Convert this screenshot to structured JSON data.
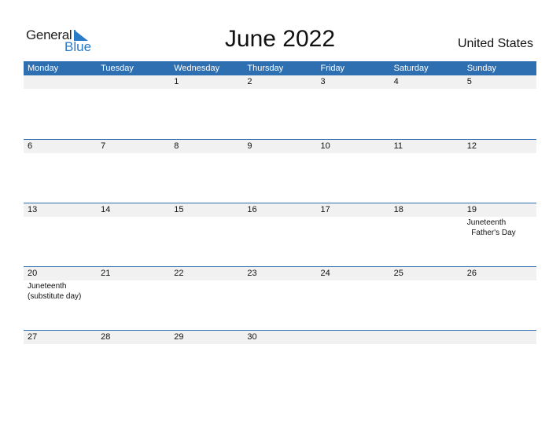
{
  "logo": {
    "word1": "General",
    "word2": "Blue"
  },
  "title": "June 2022",
  "country": "United States",
  "colors": {
    "header_bg": "#2e6fb1",
    "brand_blue": "#2a7bc7",
    "daynum_bg": "#f1f1f1"
  },
  "weekdays": [
    "Monday",
    "Tuesday",
    "Wednesday",
    "Thursday",
    "Friday",
    "Saturday",
    "Sunday"
  ],
  "weeks": [
    {
      "days": [
        "",
        "",
        "1",
        "2",
        "3",
        "4",
        "5"
      ],
      "events": [
        "",
        "",
        "",
        "",
        "",
        "",
        ""
      ]
    },
    {
      "days": [
        "6",
        "7",
        "8",
        "9",
        "10",
        "11",
        "12"
      ],
      "events": [
        "",
        "",
        "",
        "",
        "",
        "",
        ""
      ]
    },
    {
      "days": [
        "13",
        "14",
        "15",
        "16",
        "17",
        "18",
        "19"
      ],
      "events": [
        "",
        "",
        "",
        "",
        "",
        "",
        "Juneteenth\n  Father's Day"
      ]
    },
    {
      "days": [
        "20",
        "21",
        "22",
        "23",
        "24",
        "25",
        "26"
      ],
      "events": [
        "Juneteenth\n(substitute day)",
        "",
        "",
        "",
        "",
        "",
        ""
      ]
    },
    {
      "days": [
        "27",
        "28",
        "29",
        "30",
        "",
        "",
        ""
      ],
      "events": [
        "",
        "",
        "",
        "",
        "",
        "",
        ""
      ]
    }
  ]
}
